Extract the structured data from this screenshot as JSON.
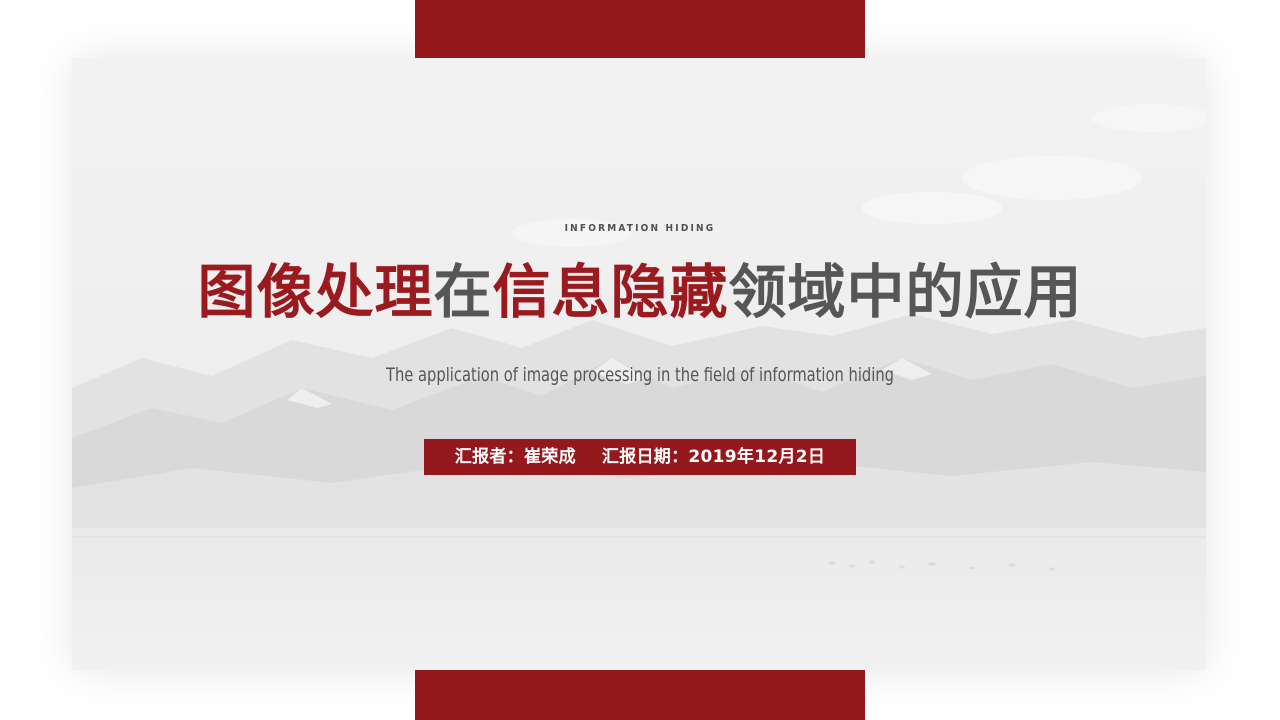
{
  "slide": {
    "eyebrow": "INFORMATION HIDING",
    "title": {
      "part1": "图像处理",
      "part2": "在",
      "part3": "信息隐藏",
      "part4": "领域中的应用"
    },
    "subtitle": "The application of image processing in the field of information hiding",
    "reporter": {
      "reporter_text": "汇报者：崔荣成",
      "date_text": "汇报日期：2019年12月2日"
    }
  },
  "colors": {
    "accent_red": "#95181d",
    "title_red": "#9b1a1f",
    "title_gray": "#565656",
    "background": "#ffffff"
  }
}
